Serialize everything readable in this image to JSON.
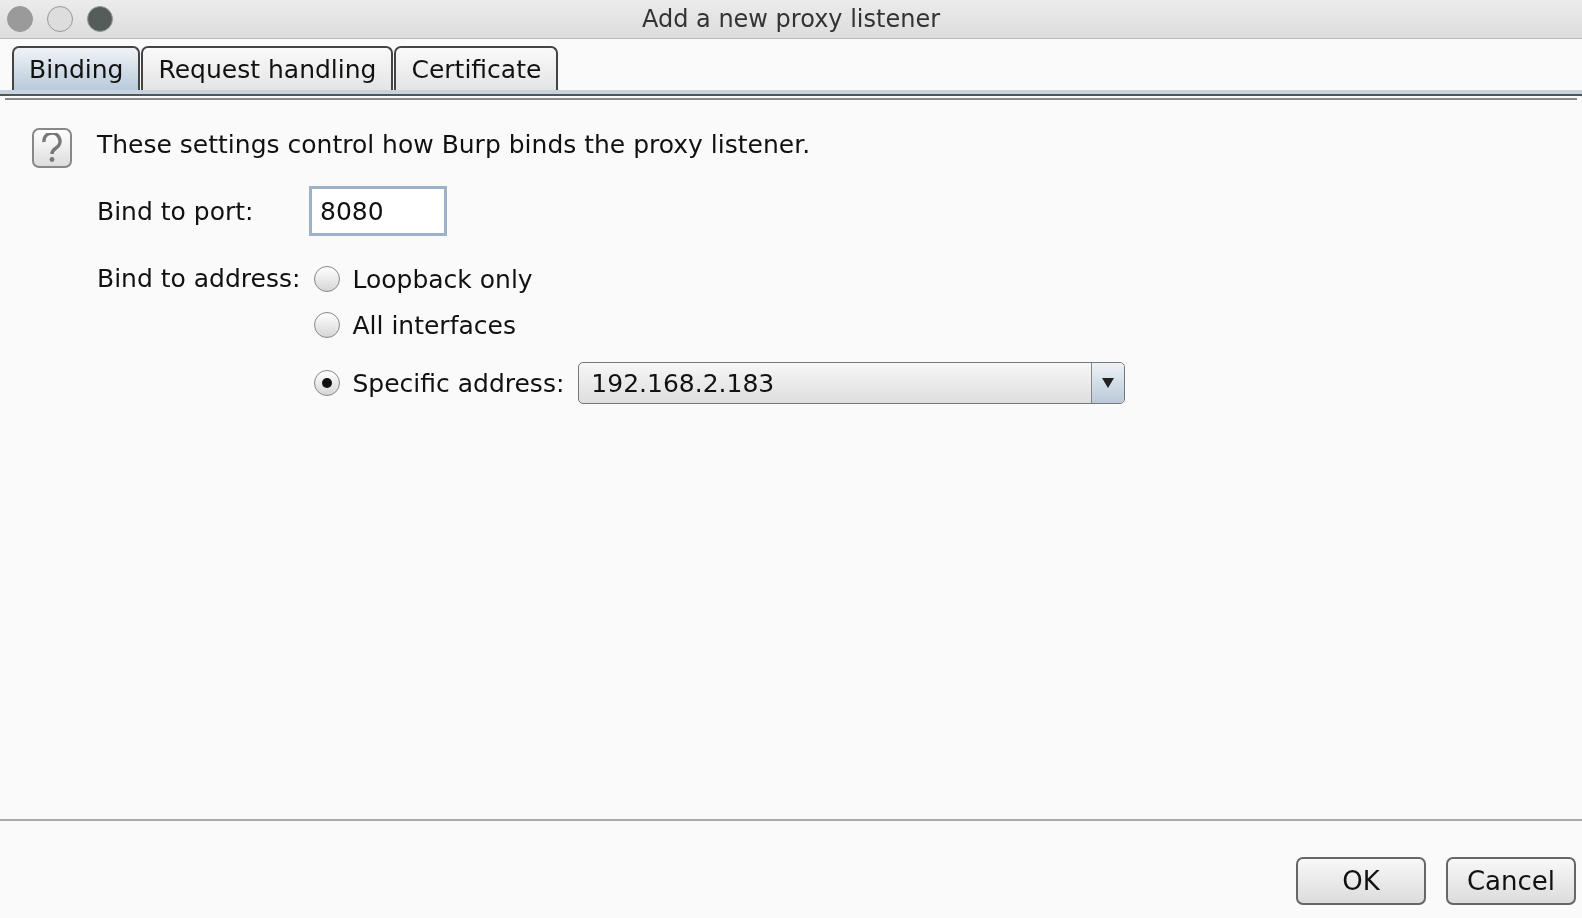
{
  "window": {
    "title": "Add a new proxy listener"
  },
  "tabs": [
    {
      "label": "Binding",
      "selected": true
    },
    {
      "label": "Request handling",
      "selected": false
    },
    {
      "label": "Certificate",
      "selected": false
    }
  ],
  "description": "These settings control how Burp binds the proxy listener.",
  "port": {
    "label": "Bind to port:",
    "value": "8080"
  },
  "address": {
    "label": "Bind to address:",
    "options": [
      {
        "label": "Loopback only",
        "selected": false
      },
      {
        "label": "All interfaces",
        "selected": false
      },
      {
        "label": "Specific address:",
        "selected": true
      }
    ],
    "dropdown_value": "192.168.2.183"
  },
  "buttons": [
    "OK",
    "Cancel"
  ]
}
